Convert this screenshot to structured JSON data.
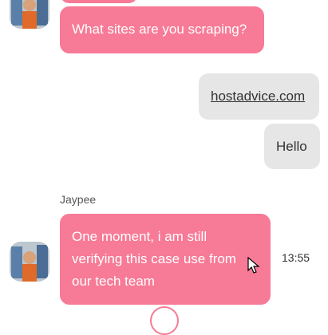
{
  "messages": [
    {
      "role": "agent",
      "text": "What sites are you scraping?"
    },
    {
      "role": "user",
      "text": "hostadvice.com",
      "is_link": true
    },
    {
      "role": "user",
      "text": "Hello"
    },
    {
      "role": "agent",
      "sender": "Jaypee",
      "text": "One moment, i am still verifying this case use from our tech team",
      "time": "13:55"
    }
  ],
  "colors": {
    "agent_bubble": "#f77a96",
    "user_bubble": "#e6e6e6"
  },
  "icons": [
    "agent-avatar-icon",
    "mouse-cursor-icon"
  ]
}
